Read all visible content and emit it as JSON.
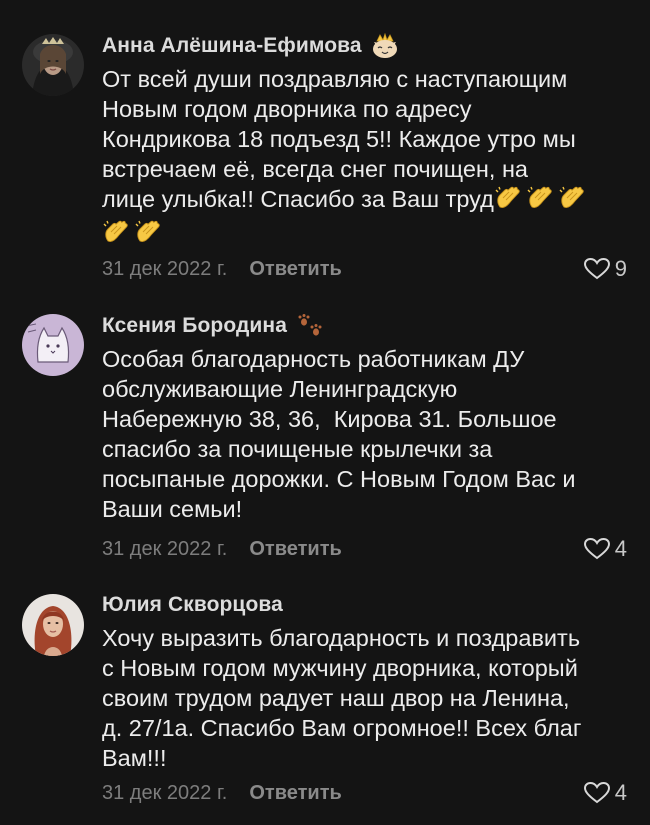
{
  "comments": [
    {
      "author": "Анна Алёшина-Ефимова",
      "badge_icon": "crowned-cat-emoji",
      "avatar_icon": "woman-portrait-avatar",
      "text_lines": [
        "От всей души поздравляю с наступающим",
        "Новым годом дворника по адресу",
        "Кондрикова 18 подъезд 5!! Каждое утро мы",
        "встречаем её, всегда снег почищен, на",
        "лице улыбка!! Спасибо за Ваш труд"
      ],
      "trailing_emoji": "clapping-hands-emoji",
      "trailing_emoji_count": 5,
      "date": "31 дек 2022 г.",
      "reply_label": "Ответить",
      "likes": "9"
    },
    {
      "author": "Ксения Бородина",
      "badge_icon": "paw-prints-emoji",
      "avatar_icon": "cat-sketch-avatar",
      "text_lines": [
        "Особая благодарность работникам ДУ",
        "обслуживающие Ленинградскую",
        "Набережную 38, 36,  Кирова 31. Большое",
        "спасибо за почищеные крылечки за",
        "посыпаные дорожки. С Новым Годом Вас и",
        "Ваши семьи!"
      ],
      "date": "31 дек 2022 г.",
      "reply_label": "Ответить",
      "likes": "4"
    },
    {
      "author": "Юлия Скворцова",
      "avatar_icon": "red-haired-woman-avatar",
      "text_lines": [
        "Хочу выразить благодарность и поздравить",
        "с Новым годом мужчину дворника, который",
        "своим трудом радует наш двор на Ленина,",
        "д. 27/1а. Спасибо Вам огромное!! Всех благ",
        "Вам!!!"
      ],
      "date": "31 дек 2022 г.",
      "reply_label": "Ответить",
      "likes": "4"
    }
  ],
  "colors": {
    "background": "#141414",
    "text": "#ececec",
    "date": "#7d7d7d",
    "reply": "#8a8a8a",
    "emoji_yellow": "#f7c844"
  }
}
